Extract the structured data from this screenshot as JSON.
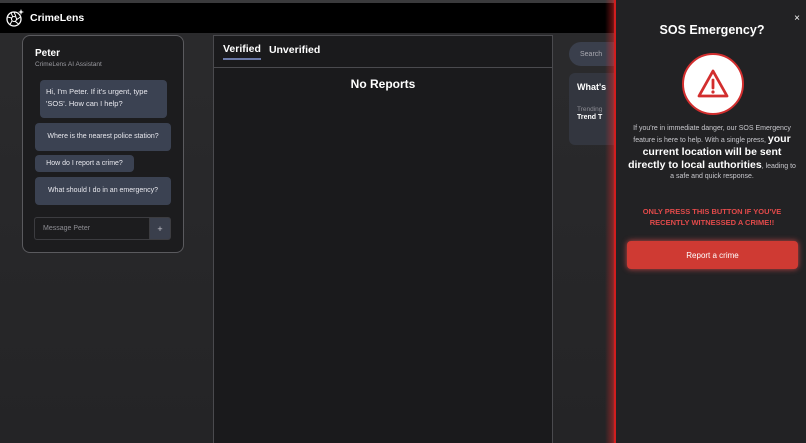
{
  "app": {
    "name": "CrimeLens",
    "logo_icon": "camera-aperture-sparkle-icon"
  },
  "chat": {
    "assistant_name": "Peter",
    "assistant_subtitle": "CrimeLens AI Assistant",
    "greeting": "Hi, I'm Peter. If it's urgent, type 'SOS'. How can I help?",
    "suggestions": [
      "Where is the nearest police station?",
      "How do I report a crime?",
      "What should I do in an emergency?"
    ],
    "input_placeholder": "Message Peter",
    "send_icon": "plus-icon",
    "send_glyph": "+"
  },
  "reports": {
    "tabs": [
      "Verified",
      "Unverified"
    ],
    "active_tab": "Verified",
    "empty_text": "No Reports"
  },
  "sidebar_right": {
    "search_placeholder": "Search",
    "whats_title": "What's",
    "trending_label": "Trending",
    "trend_item": "Trend T"
  },
  "sos": {
    "title": "SOS Emergency?",
    "close_glyph": "×",
    "icon": "warning-triangle-icon",
    "desc_pre": "If you're in immediate danger, our SOS Emergency feature is here to help. With a single press, ",
    "desc_emphasis": "your current location will be sent directly to local authorities",
    "desc_post": ", leading to a safe and quick response.",
    "warning": "ONLY PRESS THIS BUTTON IF YOU'VE RECENTLY WITNESSED A CRIME!!",
    "button_label": "Report a crime",
    "accent_color": "#cf3a33"
  }
}
